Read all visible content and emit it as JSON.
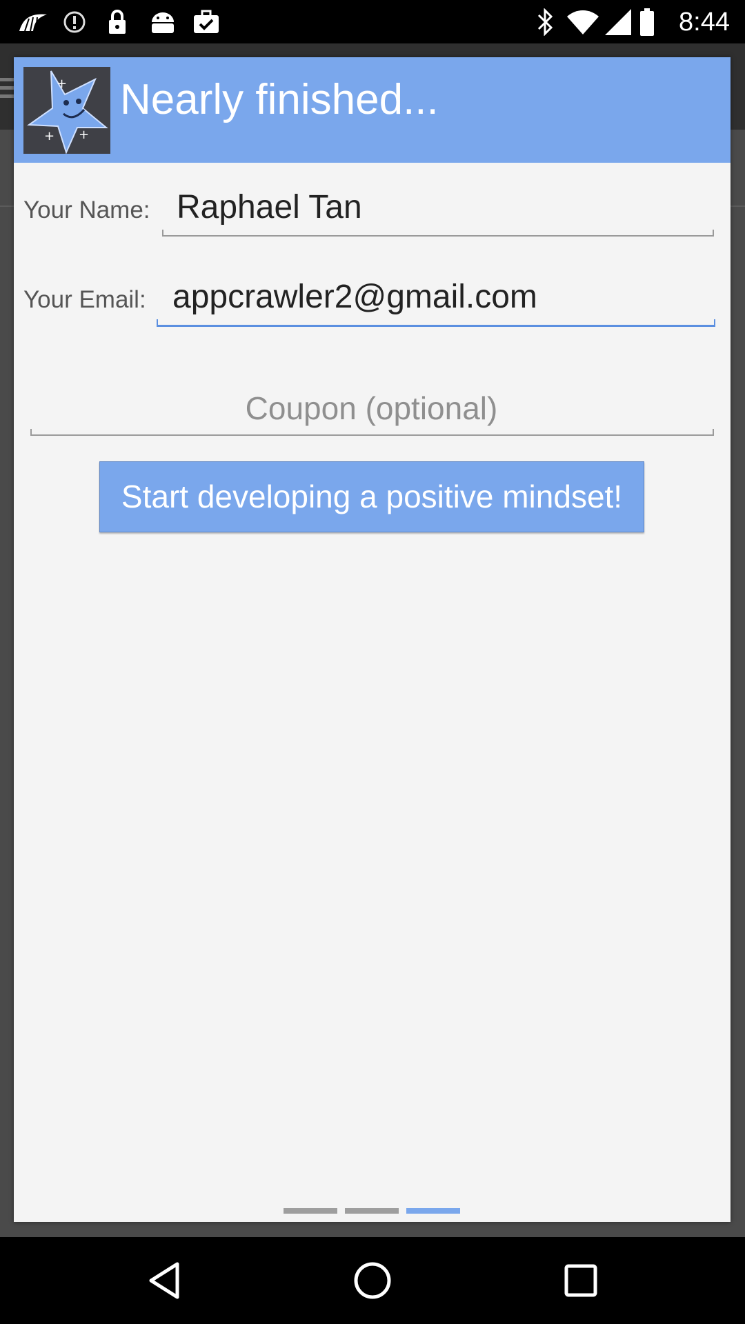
{
  "status_bar": {
    "time": "8:44",
    "left_icons": [
      "bird-notification-icon",
      "sync-icon",
      "lock-icon",
      "android-icon",
      "briefcase-check-icon"
    ],
    "right_icons": [
      "bluetooth-icon",
      "wifi-icon",
      "signal-icon",
      "battery-icon"
    ]
  },
  "dialog": {
    "title": "Nearly finished...",
    "icon": "star-mascot-icon",
    "name_label": "Your Name:",
    "name_value": "Raphael Tan",
    "email_label": "Your Email:",
    "email_value": "appcrawler2@gmail.com",
    "coupon_placeholder": "Coupon (optional)",
    "cta_label": "Start developing a positive mindset!",
    "page_indicator": {
      "total": 3,
      "active_index": 3
    }
  },
  "nav_bar": {
    "buttons": [
      "back-icon",
      "home-icon",
      "recents-icon"
    ]
  },
  "colors": {
    "accent": "#7aa7ec",
    "header_bg": "#7aa7ec",
    "dialog_bg": "#f4f4f4",
    "active_underline": "#5b8fe0"
  }
}
